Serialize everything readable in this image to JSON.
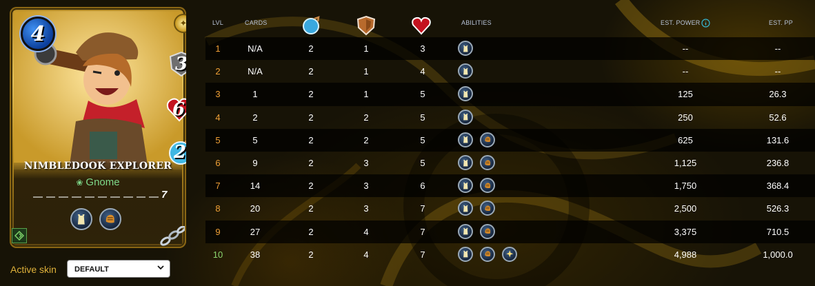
{
  "card": {
    "name": "NIMBLEDOOK EXPLORER",
    "mana": "4",
    "armor": "3",
    "health": "6",
    "ranged": "2",
    "type": "Gnome",
    "level": "7",
    "rarity_icon": "gold-star-rarity-icon",
    "element_icon": "earth-element-icon",
    "abilities_icons": [
      "tower-ability-icon",
      "glove-ability-icon"
    ],
    "colors": {
      "frame": "#d4a93a",
      "mana": "#1f5fcc",
      "type_text": "#7fd98a"
    }
  },
  "skin": {
    "label": "Active skin",
    "value": "DEFAULT"
  },
  "table": {
    "headers": {
      "lvl": "LVL",
      "cards": "CARDS",
      "speed_icon": "speed-icon",
      "attack_icon": "shield-attack-icon",
      "health_icon": "heart-icon",
      "abilities": "ABILITIES",
      "power": "EST. POWER",
      "pp": "EST. PP",
      "info_icon": "info-icon"
    },
    "rows": [
      {
        "lvl": "1",
        "cards": "N/A",
        "speed": "2",
        "attack": "1",
        "health": "3",
        "abilities": [
          "tower"
        ],
        "power": "--",
        "pp": "--"
      },
      {
        "lvl": "2",
        "cards": "N/A",
        "speed": "2",
        "attack": "1",
        "health": "4",
        "abilities": [
          "tower"
        ],
        "power": "--",
        "pp": "--"
      },
      {
        "lvl": "3",
        "cards": "1",
        "speed": "2",
        "attack": "1",
        "health": "5",
        "abilities": [
          "tower"
        ],
        "power": "125",
        "pp": "26.3"
      },
      {
        "lvl": "4",
        "cards": "2",
        "speed": "2",
        "attack": "2",
        "health": "5",
        "abilities": [
          "tower"
        ],
        "power": "250",
        "pp": "52.6"
      },
      {
        "lvl": "5",
        "cards": "5",
        "speed": "2",
        "attack": "2",
        "health": "5",
        "abilities": [
          "tower",
          "glove"
        ],
        "power": "625",
        "pp": "131.6"
      },
      {
        "lvl": "6",
        "cards": "9",
        "speed": "2",
        "attack": "3",
        "health": "5",
        "abilities": [
          "tower",
          "glove"
        ],
        "power": "1,125",
        "pp": "236.8"
      },
      {
        "lvl": "7",
        "cards": "14",
        "speed": "2",
        "attack": "3",
        "health": "6",
        "abilities": [
          "tower",
          "glove"
        ],
        "power": "1,750",
        "pp": "368.4"
      },
      {
        "lvl": "8",
        "cards": "20",
        "speed": "2",
        "attack": "3",
        "health": "7",
        "abilities": [
          "tower",
          "glove"
        ],
        "power": "2,500",
        "pp": "526.3"
      },
      {
        "lvl": "9",
        "cards": "27",
        "speed": "2",
        "attack": "4",
        "health": "7",
        "abilities": [
          "tower",
          "glove"
        ],
        "power": "3,375",
        "pp": "710.5"
      },
      {
        "lvl": "10",
        "cards": "38",
        "speed": "2",
        "attack": "4",
        "health": "7",
        "abilities": [
          "tower",
          "glove",
          "star"
        ],
        "power": "4,988",
        "pp": "1,000.0"
      }
    ],
    "colors": {
      "lvl": "#f0a036",
      "max_lvl": "#8bd46d",
      "header": "#b7c3d9"
    }
  }
}
